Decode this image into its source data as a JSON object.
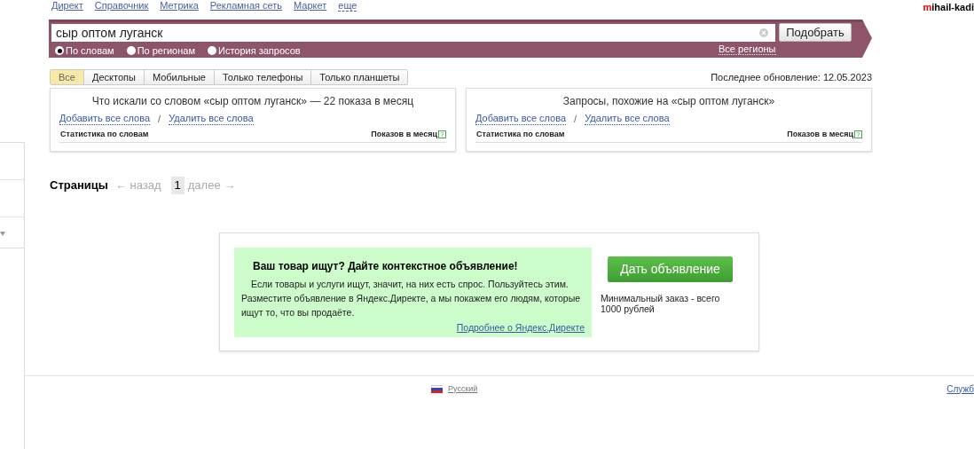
{
  "top_nav": {
    "links": [
      {
        "label": "Директ",
        "kind": "link"
      },
      {
        "label": "Справочник",
        "kind": "link"
      },
      {
        "label": "Метрика",
        "kind": "link"
      },
      {
        "label": "Рекламная сеть",
        "kind": "link"
      },
      {
        "label": "Маркет",
        "kind": "link"
      },
      {
        "label": "еще",
        "kind": "menu"
      }
    ]
  },
  "user": {
    "login_first": "m",
    "login_rest": "ihail-kadi"
  },
  "search": {
    "value": "сыр оптом луганск",
    "button": "Подобрать",
    "regions_link": "Все регионы",
    "modes": [
      {
        "label": "По словам",
        "selected": true
      },
      {
        "label": "По регионам",
        "selected": false
      },
      {
        "label": "История запросов",
        "selected": false
      }
    ]
  },
  "device_tabs": [
    {
      "label": "Все",
      "selected": true
    },
    {
      "label": "Десктопы",
      "selected": false
    },
    {
      "label": "Мобильные",
      "selected": false
    },
    {
      "label": "Только телефоны",
      "selected": false
    },
    {
      "label": "Только планшеты",
      "selected": false
    }
  ],
  "last_update": "Последнее обновление: 12.05.2023",
  "panels": [
    {
      "title": "Что искали со словом «сыр оптом луганск» — 22 показа в месяц",
      "add": "Добавить все слова",
      "sep": "/",
      "remove": "Удалить все слова",
      "col_1": "Статистика по словам",
      "col_2": "Показов в месяц",
      "help": "?"
    },
    {
      "title": "Запросы, похожие на «сыр оптом луганск»",
      "add": "Добавить все слова",
      "sep": "/",
      "remove": "Удалить все слова",
      "col_1": "Статистика по словам",
      "col_2": "Показов в месяц",
      "help": "?"
    }
  ],
  "pager": {
    "label": "Страницы",
    "prev": "← назад",
    "page": "1",
    "next": "далее →"
  },
  "promo": {
    "title": "Ваш товар ищут? Дайте контекстное объявление!",
    "text": "Если товары и услуги ищут, значит, на них есть спрос. Пользуйтесь этим. Разместите объявление в Яндекс.Директе, а мы покажем его людям, которые ищут то, что вы продаёте.",
    "more": "Подробнее о Яндекс.Директе",
    "button": "Дать объявление",
    "min_order": "Минимальный заказ - всего 1000 рублей"
  },
  "footer": {
    "language": "Русский",
    "right_link": "Служб"
  }
}
